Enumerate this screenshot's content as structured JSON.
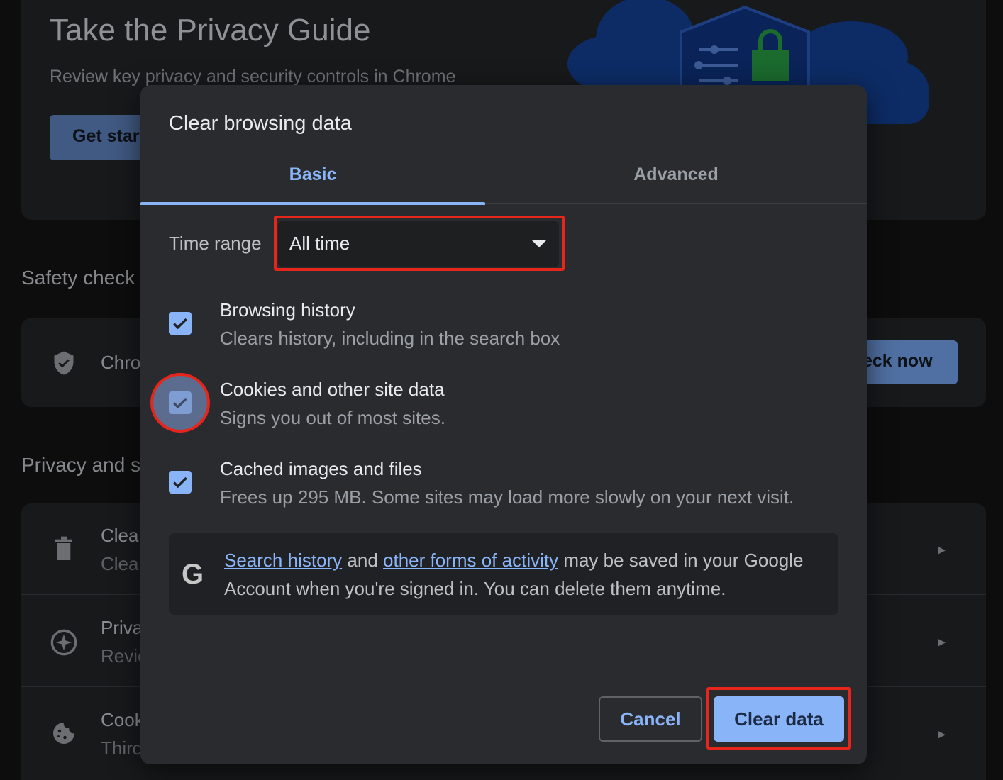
{
  "background": {
    "privacy_guide": {
      "title": "Take the Privacy Guide",
      "subtitle": "Review key privacy and security controls in Chrome",
      "button_label": "Get start"
    },
    "safety_check": {
      "section_label": "Safety check",
      "row_title": "Chro",
      "button_label": "eck now"
    },
    "privacy_section": {
      "section_label": "Privacy and s",
      "rows": [
        {
          "title": "Clear",
          "subtitle": "Clear",
          "icon": "trash-icon"
        },
        {
          "title": "Priva",
          "subtitle": "Revie",
          "icon": "compass-icon"
        },
        {
          "title": "Cook",
          "subtitle": "Third",
          "icon": "cookie-icon"
        }
      ]
    }
  },
  "dialog": {
    "title": "Clear browsing data",
    "tabs": [
      {
        "label": "Basic",
        "active": true
      },
      {
        "label": "Advanced",
        "active": false
      }
    ],
    "time_range": {
      "label": "Time range",
      "value": "All time"
    },
    "options": [
      {
        "title": "Browsing history",
        "subtitle": "Clears history, including in the search box",
        "checked": true
      },
      {
        "title": "Cookies and other site data",
        "subtitle": "Signs you out of most sites.",
        "checked": true
      },
      {
        "title": "Cached images and files",
        "subtitle": "Frees up 295 MB. Some sites may load more slowly on your next visit.",
        "checked": true
      }
    ],
    "google_notice": {
      "icon": "G",
      "link1": "Search history",
      "and": " and ",
      "link2": "other forms of activity",
      "rest": " may be saved in your Google Account when you're signed in. You can delete them anytime."
    },
    "cancel_label": "Cancel",
    "clear_label": "Clear data"
  },
  "colors": {
    "accent": "#8ab4f8",
    "highlight": "#e8251b",
    "dialog_bg": "#2a2b2f"
  }
}
